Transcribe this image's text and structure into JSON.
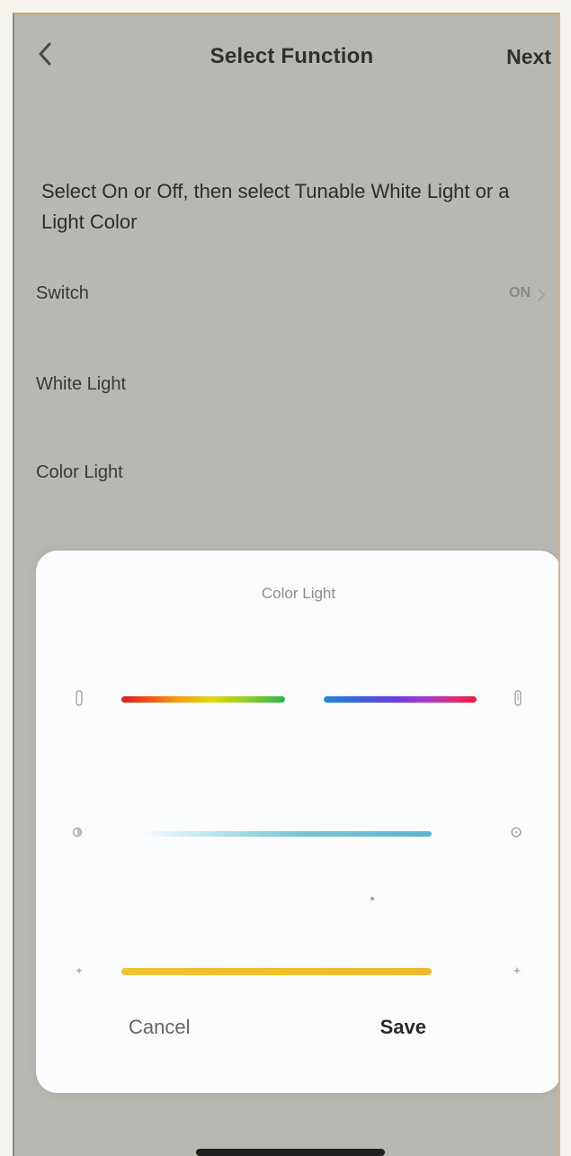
{
  "header": {
    "title": "Select Function",
    "next_label": "Next"
  },
  "instructions": "Select On or Off, then select Tunable White Light or a Light Color",
  "rows": [
    {
      "label": "Switch",
      "value": "ON"
    },
    {
      "label": "White Light",
      "value": ""
    },
    {
      "label": "Color Light",
      "value": ""
    }
  ],
  "sheet": {
    "title": "Color Light",
    "cancel_label": "Cancel",
    "save_label": "Save"
  },
  "icons": {
    "back": "chevron-left-icon",
    "switch_chevron": "chevron-right-icon",
    "hue_left": "hue-icon",
    "hue_right": "hue-icon",
    "brightness_left": "moon-icon",
    "brightness_right": "sun-icon",
    "temp_left": "star-icon",
    "temp_right": "star-icon"
  },
  "colors": {
    "screen_background": "#b9b7b2",
    "sheet_background": "#fbfcfd",
    "primary_text": "#30302e",
    "muted_text": "#8d8d8d"
  }
}
